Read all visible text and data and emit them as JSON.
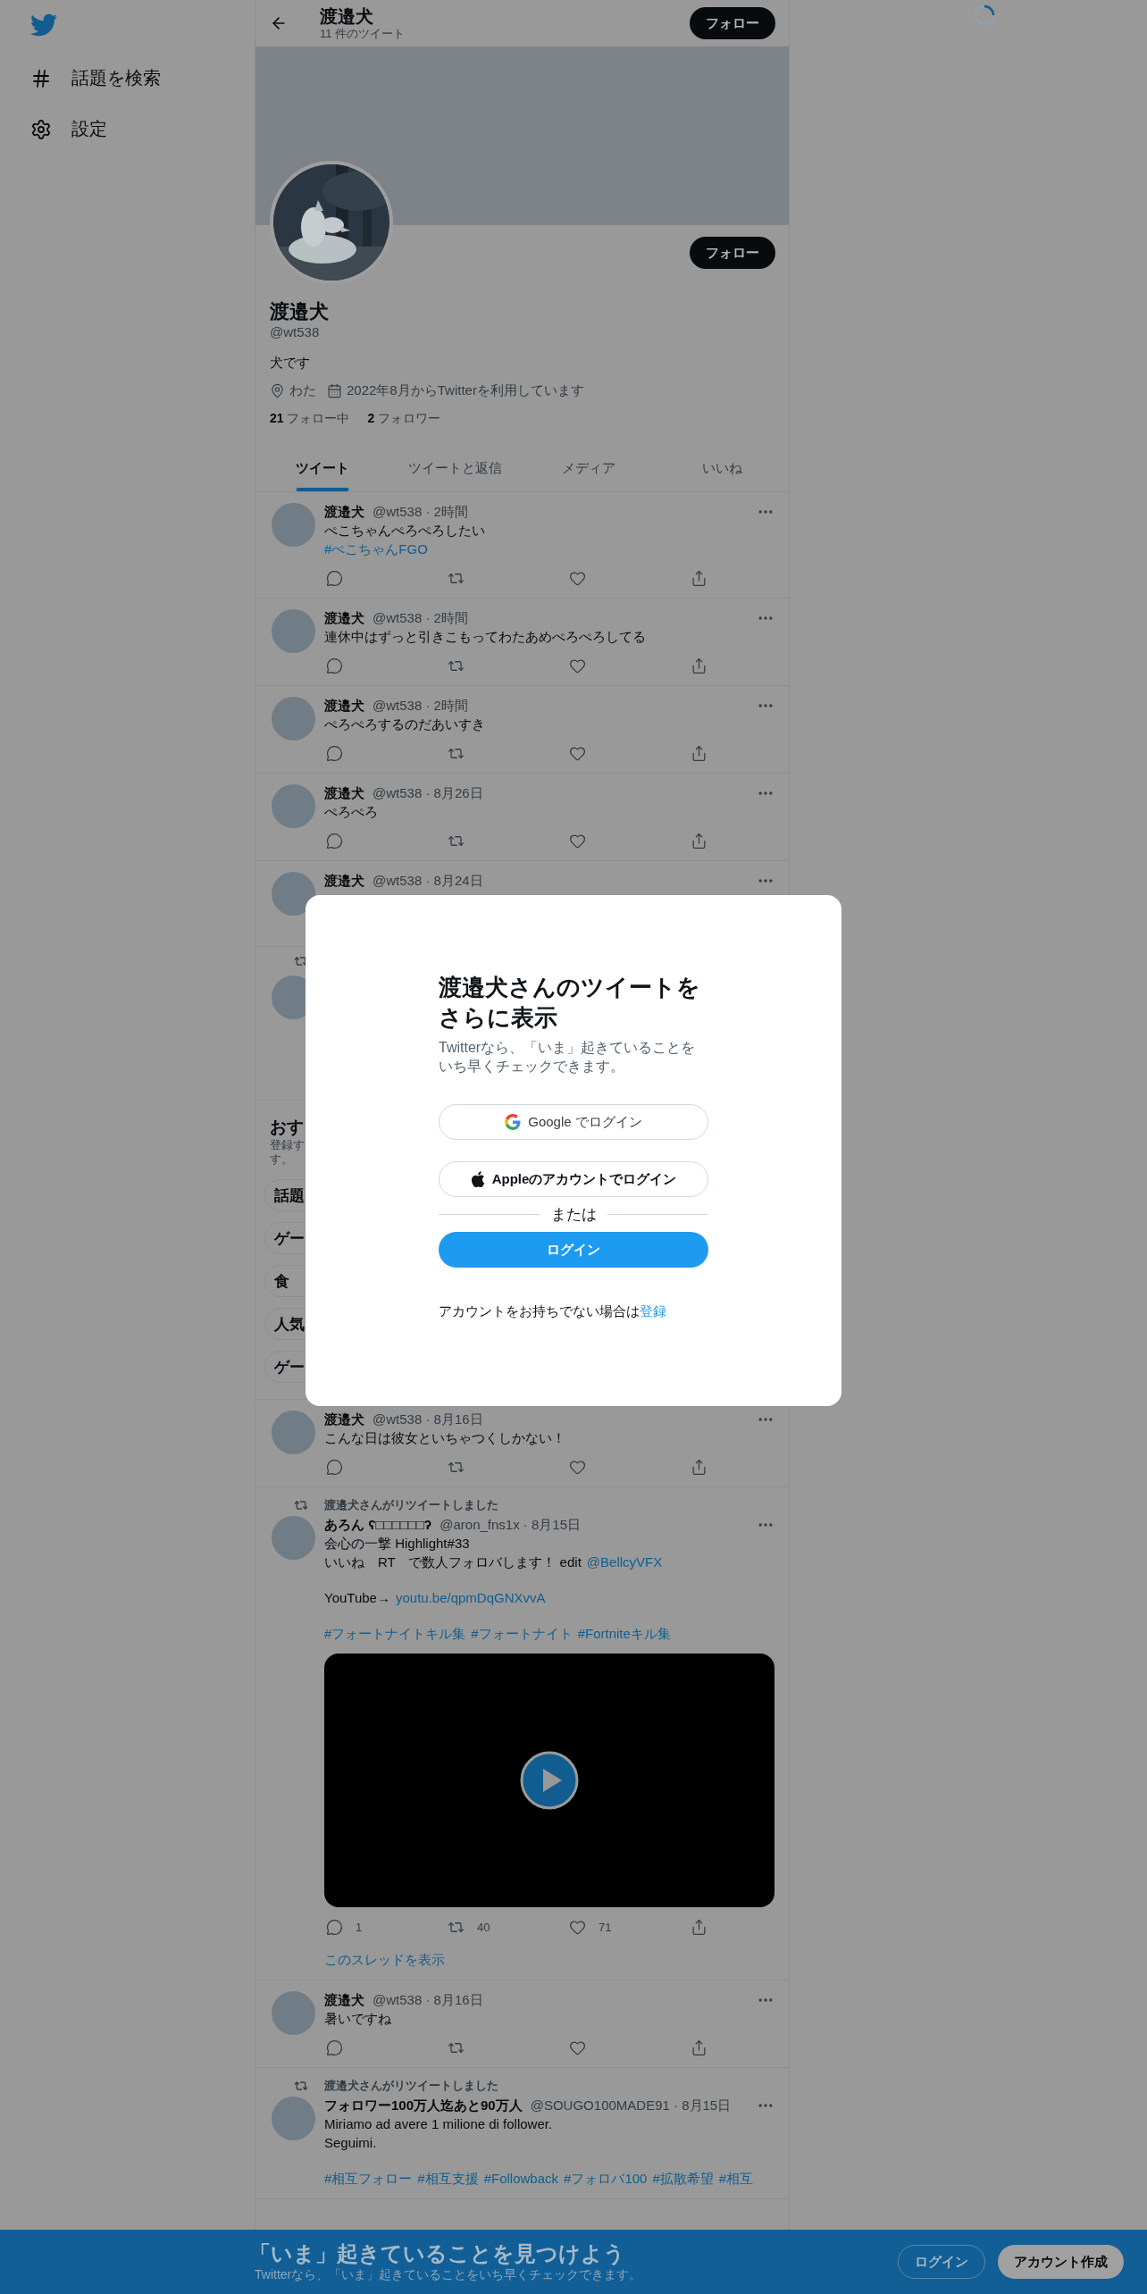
{
  "sidebar": {
    "items": [
      {
        "kind": "hash",
        "label": "話題を検索"
      },
      {
        "kind": "gear",
        "label": "設定"
      }
    ]
  },
  "header": {
    "title": "渡邉犬",
    "subtitle": "11 件のツイート",
    "button": "フォロー"
  },
  "profile": {
    "follow_button": "フォロー",
    "name": "渡邉犬",
    "handle": "@wt538",
    "bio": "犬です",
    "details": [
      {
        "kind": "location",
        "text": "わた"
      },
      {
        "kind": "joined",
        "text": "2022年8月からTwitterを利用しています"
      }
    ],
    "stats": [
      "**21** フォロー中",
      "**2** フォロワー"
    ]
  },
  "tabs": [
    {
      "label": "ツイート",
      "selected": true
    },
    {
      "label": "ツイートと返信",
      "selected": false
    },
    {
      "label": "メディア",
      "selected": false
    },
    {
      "label": "いいね",
      "selected": false
    }
  ],
  "timeline": [
    {
      "kind": "tweet",
      "name": "渡邉犬",
      "meta": "@wt538 · 2時間",
      "paragraphs": [
        {
          "lines": [
            [
              {
                "kind": "text",
                "text": "ぺこちゃんぺろぺろしたい"
              }
            ],
            [
              {
                "kind": "hashtag",
                "text": "#ぺこちゃんFGO"
              }
            ]
          ]
        }
      ],
      "actions": [
        {
          "kind": "reply"
        },
        {
          "kind": "retweet"
        },
        {
          "kind": "like"
        },
        {
          "kind": "share"
        }
      ]
    },
    {
      "kind": "tweet",
      "name": "渡邉犬",
      "meta": "@wt538 · 2時間",
      "paragraphs": [
        {
          "lines": [
            [
              {
                "kind": "text",
                "text": "連休中はずっと引きこもってわたあめぺろぺろしてる"
              }
            ]
          ]
        }
      ],
      "actions": [
        {
          "kind": "reply"
        },
        {
          "kind": "retweet"
        },
        {
          "kind": "like"
        },
        {
          "kind": "share"
        }
      ]
    },
    {
      "kind": "tweet",
      "name": "渡邉犬",
      "meta": "@wt538 · 2時間",
      "paragraphs": [
        {
          "lines": [
            [
              {
                "kind": "text",
                "text": "ぺろぺろするのだあいすき"
              }
            ]
          ]
        }
      ],
      "actions": [
        {
          "kind": "reply"
        },
        {
          "kind": "retweet"
        },
        {
          "kind": "like"
        },
        {
          "kind": "share"
        }
      ]
    },
    {
      "kind": "tweet",
      "name": "渡邉犬",
      "meta": "@wt538 · 8月26日",
      "paragraphs": [
        {
          "lines": [
            [
              {
                "kind": "text",
                "text": "ぺろぺろ"
              }
            ]
          ]
        }
      ],
      "actions": [
        {
          "kind": "reply"
        },
        {
          "kind": "retweet"
        },
        {
          "kind": "like"
        },
        {
          "kind": "share"
        }
      ]
    },
    {
      "kind": "tweet",
      "name": "渡邉犬",
      "meta": "@wt538 · 8月24日"
    },
    {
      "kind": "retweet_stub"
    },
    {
      "kind": "suggestions",
      "title": "おす",
      "subtitle_lines": [
        "登録す",
        "す。"
      ],
      "chips": [
        "話題",
        "ゲー",
        "食",
        "人気",
        "ゲー"
      ]
    },
    {
      "kind": "tweet",
      "name": "渡邉犬",
      "meta": "@wt538 · 8月16日",
      "paragraphs": [
        {
          "lines": [
            [
              {
                "kind": "text",
                "text": "こんな日は彼女といちゃつくしかない！"
              }
            ]
          ]
        }
      ],
      "actions": [
        {
          "kind": "reply"
        },
        {
          "kind": "retweet"
        },
        {
          "kind": "like"
        },
        {
          "kind": "share"
        }
      ]
    },
    {
      "kind": "tweet",
      "retweeted_by": "渡邉犬さんがリツイートしました",
      "name": "あろん ʕ□□□□□□ʔ",
      "meta": "@aron_fns1x · 8月15日",
      "paragraphs": [
        {
          "lines": [
            [
              {
                "kind": "text",
                "text": "会心の一撃 Highlight#33"
              }
            ],
            [
              {
                "kind": "text",
                "text": "いいね　RT　で数人フォロバします！ edit"
              },
              {
                "kind": "mention",
                "text": "@BellcyVFX"
              }
            ]
          ]
        },
        {
          "lines": [
            [
              {
                "kind": "text",
                "text": "YouTube→"
              },
              {
                "kind": "url",
                "text": "youtu.be/qpmDqGNXvvA"
              }
            ]
          ]
        },
        {
          "lines": [
            [
              {
                "kind": "hashtag",
                "text": "#フォートナイトキル集"
              },
              {
                "kind": "hashtag",
                "text": "#フォートナイト"
              },
              {
                "kind": "hashtag",
                "text": "#Fortniteキル集"
              }
            ]
          ]
        }
      ],
      "media": {
        "kind": "video"
      },
      "actions": [
        {
          "kind": "reply",
          "count": "1"
        },
        {
          "kind": "retweet",
          "count": "40"
        },
        {
          "kind": "like",
          "count": "71"
        },
        {
          "kind": "share"
        }
      ],
      "thread_link": "このスレッドを表示"
    },
    {
      "kind": "tweet",
      "name": "渡邉犬",
      "meta": "@wt538 · 8月16日",
      "paragraphs": [
        {
          "lines": [
            [
              {
                "kind": "text",
                "text": "暑いですね"
              }
            ]
          ]
        }
      ],
      "actions": [
        {
          "kind": "reply"
        },
        {
          "kind": "retweet"
        },
        {
          "kind": "like"
        },
        {
          "kind": "share"
        }
      ]
    },
    {
      "kind": "tweet",
      "retweeted_by": "渡邉犬さんがリツイートしました",
      "name": "フォロワー100万人迄あと90万人",
      "meta": "@SOUGO100MADE91 · 8月15日",
      "paragraphs": [
        {
          "lines": [
            [
              {
                "kind": "text",
                "text": "Miriamo ad avere 1 milione di follower."
              }
            ],
            [
              {
                "kind": "text",
                "text": "Seguimi."
              }
            ]
          ]
        },
        {
          "lines": [
            [
              {
                "kind": "hashtag",
                "text": "#相互フォロー"
              },
              {
                "kind": "hashtag",
                "text": "#相互支援"
              },
              {
                "kind": "hashtag",
                "text": "#Followback"
              },
              {
                "kind": "hashtag",
                "text": "#フォロバ100"
              },
              {
                "kind": "hashtag",
                "text": "#拡散希望"
              },
              {
                "kind": "hashtag",
                "text": "#相互"
              }
            ]
          ]
        }
      ]
    }
  ],
  "modal": {
    "title": "渡邉犬さんのツイートをさらに表示",
    "subtitle": "Twitterなら、「いま」起きていることをいち早くチェックできます。",
    "buttons": [
      {
        "kind": "google",
        "label": "Google でログイン"
      },
      {
        "kind": "apple",
        "label": "Appleのアカウントでログイン"
      }
    ],
    "divider": "または",
    "login_button": "ログイン",
    "footer": {
      "text": "アカウントをお持ちでない場合は",
      "link": "登録"
    }
  },
  "bottom_bar": {
    "title": "「いま」起きていることを見つけよう",
    "subtitle": "Twitterなら、「いま」起きていることをいち早くチェックできます。",
    "login_button": "ログイン",
    "signup_button": "アカウント作成"
  }
}
